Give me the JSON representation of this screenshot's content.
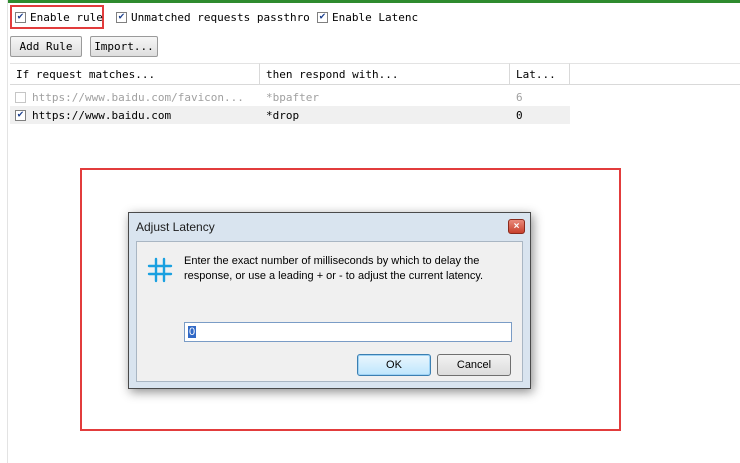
{
  "toolbar": {
    "enable_rule": {
      "label": "Enable rule",
      "checked": true
    },
    "unmatched_passthrough": {
      "label": "Unmatched requests passthro",
      "checked": true
    },
    "enable_latency": {
      "label": "Enable Latenc",
      "checked": true
    },
    "add_rule_label": "Add Rule",
    "import_label": "Import..."
  },
  "rules_table": {
    "columns": [
      "If request matches...",
      "then respond with...",
      "Lat..."
    ],
    "rows": [
      {
        "checked": false,
        "match": "https://www.baidu.com/favicon...",
        "action": "*bpafter",
        "latency": "6",
        "enabled": false
      },
      {
        "checked": true,
        "match": "https://www.baidu.com",
        "action": "*drop",
        "latency": "0",
        "enabled": true
      }
    ]
  },
  "dialog": {
    "title": "Adjust Latency",
    "close_glyph": "×",
    "message": "Enter the exact number of milliseconds by which to delay the response, or use a leading + or - to adjust the current latency.",
    "input_value": "0",
    "ok_label": "OK",
    "cancel_label": "Cancel",
    "icon": "fiddler-icon"
  },
  "colors": {
    "highlight": "#e23c3c",
    "accent_top": "#2e8b2e",
    "selection": "#3169c6"
  }
}
